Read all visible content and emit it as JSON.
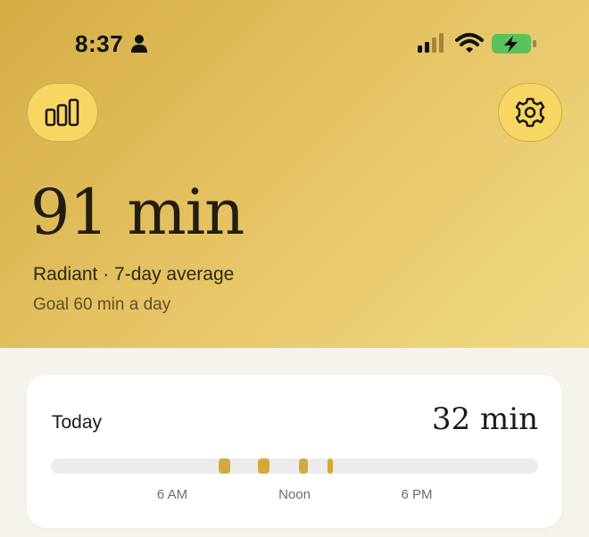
{
  "status_bar": {
    "time": "8:37"
  },
  "hero": {
    "value": "91 min",
    "subtitle": "Radiant · 7-day average",
    "goal": "Goal 60 min a day"
  },
  "header": {
    "stats_icon": "bar-chart-icon",
    "settings_icon": "gear-icon"
  },
  "today_card": {
    "title": "Today",
    "value": "32 min",
    "timeline_labels": [
      "6 AM",
      "Noon",
      "6 PM"
    ]
  },
  "colors": {
    "accent": "#d4a93c",
    "button_fill": "#f7d664",
    "background": "#f6f3ec",
    "battery_green": "#5bc15b"
  }
}
